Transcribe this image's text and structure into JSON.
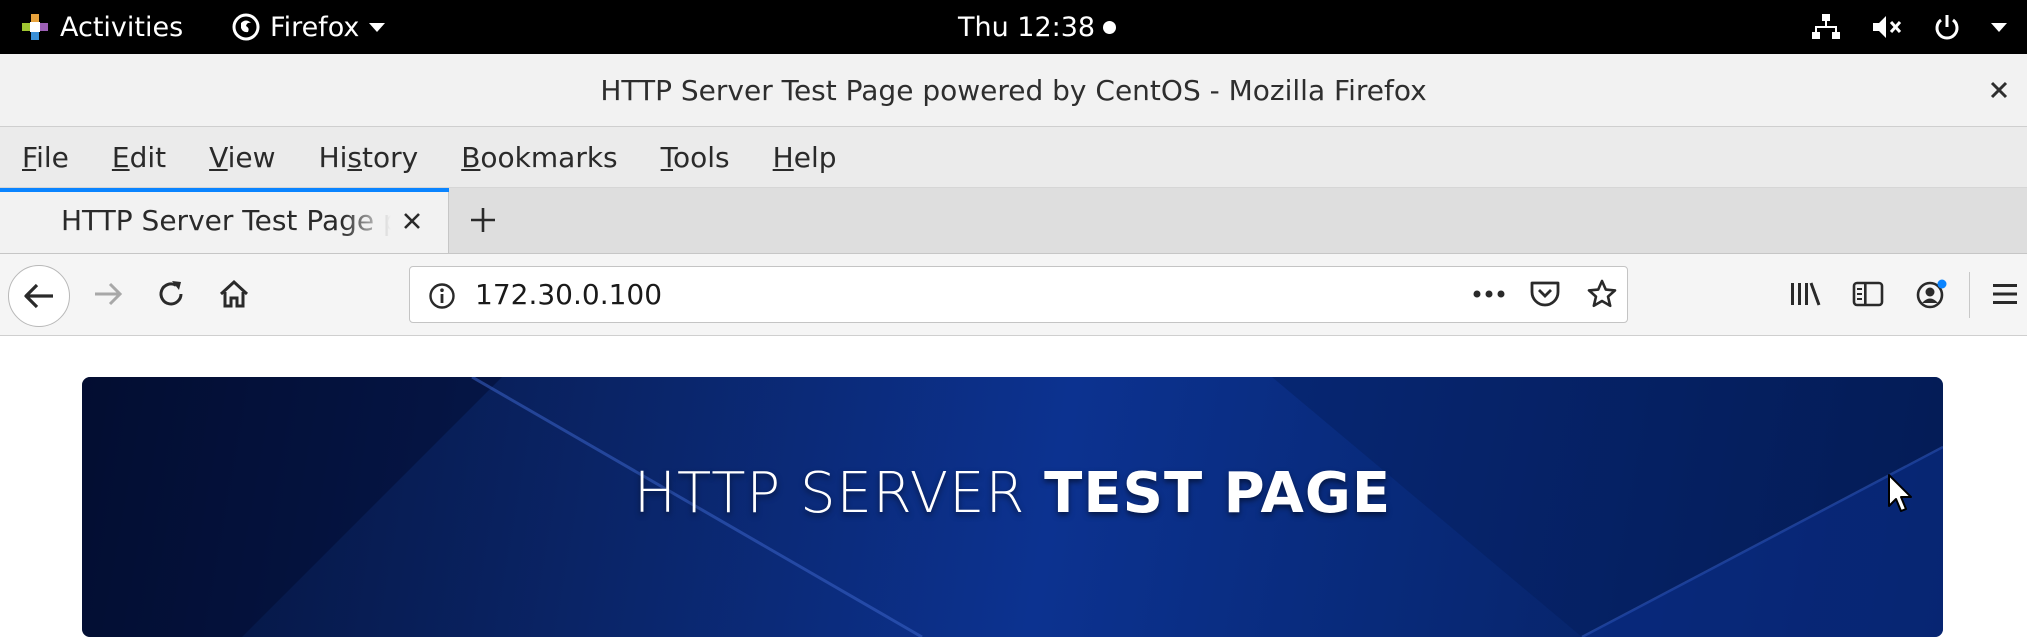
{
  "topbar": {
    "activities_label": "Activities",
    "app_name": "Firefox",
    "clock": "Thu 12:38",
    "icons": [
      "network-icon",
      "volume-muted-icon",
      "power-icon",
      "chevron-down-icon"
    ]
  },
  "window": {
    "title": "HTTP Server Test Page powered by CentOS - Mozilla Firefox",
    "close_label": "×"
  },
  "menubar": {
    "items": [
      {
        "pre": "",
        "ul": "F",
        "post": "ile"
      },
      {
        "pre": "",
        "ul": "E",
        "post": "dit"
      },
      {
        "pre": "",
        "ul": "V",
        "post": "iew"
      },
      {
        "pre": "Hi",
        "ul": "s",
        "post": "tory"
      },
      {
        "pre": "",
        "ul": "B",
        "post": "ookmarks"
      },
      {
        "pre": "",
        "ul": "T",
        "post": "ools"
      },
      {
        "pre": "",
        "ul": "H",
        "post": "elp"
      }
    ]
  },
  "tabs": {
    "active_title": "HTTP Server Test Page powered by CentOS",
    "accent_color": "#0a84ff"
  },
  "navbar": {
    "url": "172.30.0.100"
  },
  "page": {
    "heading_light": "HTTP SERVER ",
    "heading_bold": "TEST PAGE"
  }
}
